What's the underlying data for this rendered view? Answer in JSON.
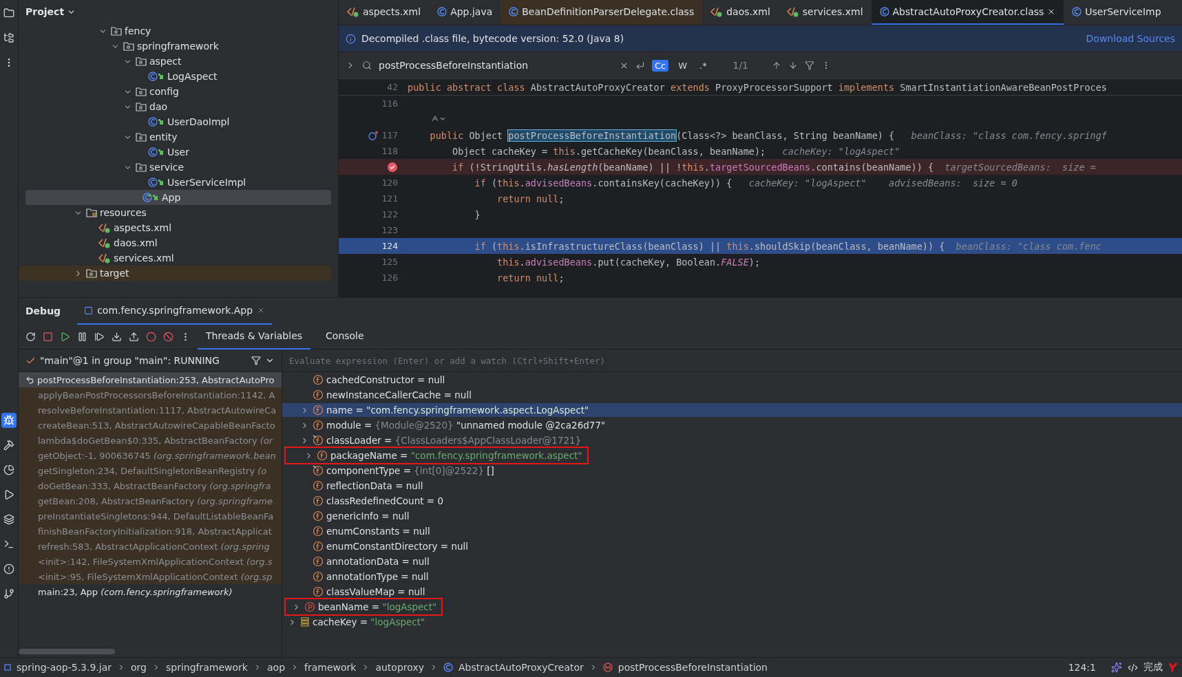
{
  "project": {
    "title": "Project",
    "tree": {
      "continued": [
        {
          "label": "fency",
          "kind": "folder",
          "expanded": true,
          "selected": false,
          "excluded": false,
          "children": [
            {
              "label": "springframework",
              "kind": "folder",
              "expanded": true,
              "selected": false,
              "excluded": false,
              "children": [
                {
                  "label": "aspect",
                  "kind": "folder",
                  "expanded": true,
                  "selected": false,
                  "excluded": false,
                  "children": [
                    {
                      "label": "LogAspect",
                      "kind": "class",
                      "selected": false,
                      "excluded": false
                    }
                  ]
                },
                {
                  "label": "config",
                  "kind": "folder",
                  "expanded": true,
                  "selected": false,
                  "excluded": false
                },
                {
                  "label": "dao",
                  "kind": "folder",
                  "expanded": true,
                  "selected": false,
                  "excluded": false,
                  "children": [
                    {
                      "label": "UserDaoImpl",
                      "kind": "class",
                      "selected": false,
                      "excluded": false
                    }
                  ]
                },
                {
                  "label": "entity",
                  "kind": "folder",
                  "expanded": true,
                  "selected": false,
                  "excluded": false,
                  "children": [
                    {
                      "label": "User",
                      "kind": "class",
                      "selected": false,
                      "excluded": false
                    }
                  ]
                },
                {
                  "label": "service",
                  "kind": "folder",
                  "expanded": true,
                  "selected": false,
                  "excluded": false,
                  "children": [
                    {
                      "label": "UserServiceImpl",
                      "kind": "class",
                      "selected": false,
                      "excluded": false
                    }
                  ]
                },
                {
                  "label": "App",
                  "kind": "main-class",
                  "selected": true,
                  "excluded": false
                }
              ]
            }
          ]
        }
      ],
      "items": [
        {
          "label": "resources",
          "kind": "resources",
          "expanded": true,
          "selected": false,
          "excluded": false,
          "children": [
            {
              "label": "aspects.xml",
              "kind": "xml",
              "selected": false,
              "excluded": false
            },
            {
              "label": "daos.xml",
              "kind": "xml",
              "selected": false,
              "excluded": false
            },
            {
              "label": "services.xml",
              "kind": "xml",
              "selected": false,
              "excluded": false
            }
          ]
        },
        {
          "label": "target",
          "kind": "folder",
          "expanded": false,
          "selected": false,
          "excluded": true
        }
      ]
    }
  },
  "editor": {
    "tabs": [
      {
        "label": "aspects.xml",
        "kind": "xml",
        "selected": false,
        "tinted": false
      },
      {
        "label": "App.java",
        "kind": "class",
        "selected": false,
        "tinted": false
      },
      {
        "label": "BeanDefinitionParserDelegate.class",
        "kind": "class",
        "selected": false,
        "tinted": true
      },
      {
        "label": "daos.xml",
        "kind": "xml",
        "selected": false,
        "tinted": false
      },
      {
        "label": "services.xml",
        "kind": "xml",
        "selected": false,
        "tinted": false
      },
      {
        "label": "AbstractAutoProxyCreator.class",
        "kind": "class",
        "selected": true,
        "tinted": false
      },
      {
        "label": "UserServiceImp",
        "kind": "class",
        "selected": false,
        "tinted": false
      }
    ],
    "banner": {
      "text": "Decompiled .class file, bytecode version: 52.0 (Java 8)",
      "link": "Download Sources"
    },
    "find": {
      "value": "postProcessBeforeInstantiation",
      "match_case": true,
      "words": false,
      "regex": false,
      "case_label": "Cc",
      "words_label": "W",
      "regex_label": ".*",
      "count": "1/1"
    },
    "lines": [
      {
        "kind": "code",
        "number": "42",
        "sticky": true,
        "breakpoint": false,
        "current": false,
        "tokens": [
          {
            "text": "public abstract class ",
            "kind": "kw"
          },
          {
            "text": "AbstractAutoProxyCreator ",
            "kind": "plain"
          },
          {
            "text": "extends ",
            "kind": "kw"
          },
          {
            "text": "ProxyProcessorSupport ",
            "kind": "plain"
          },
          {
            "text": "implements ",
            "kind": "kw"
          },
          {
            "text": "SmartInstantiationAwareBeanPostProces",
            "kind": "plain"
          }
        ]
      },
      {
        "kind": "code",
        "number": "116",
        "sticky": false,
        "breakpoint": false,
        "current": false
      },
      {
        "kind": "hint"
      },
      {
        "kind": "code",
        "number": "117",
        "sticky": false,
        "breakpoint": false,
        "current": false,
        "override": true,
        "tokens": [
          {
            "text": "    public ",
            "kind": "kw"
          },
          {
            "text": "Object ",
            "kind": "plain"
          },
          {
            "text": "postProcessBeforeInstantiation",
            "kind": "match"
          },
          {
            "text": "(Class<?> beanClass, String beanName) {   ",
            "kind": "plain"
          },
          {
            "text": "beanClass: \"class com.fency.springf",
            "kind": "hint"
          }
        ]
      },
      {
        "kind": "code",
        "number": "118",
        "sticky": false,
        "breakpoint": false,
        "current": false,
        "tokens": [
          {
            "text": "        Object cacheKey = ",
            "kind": "plain"
          },
          {
            "text": "this",
            "kind": "kw"
          },
          {
            "text": ".getCacheKey(beanClass, beanName);   ",
            "kind": "plain"
          },
          {
            "text": "cacheKey: \"logAspect\"",
            "kind": "hint"
          }
        ]
      },
      {
        "kind": "code",
        "sticky": false,
        "breakpoint": true,
        "current": false,
        "tokens": [
          {
            "text": "        if ",
            "kind": "kw"
          },
          {
            "text": "(!StringUtils.",
            "kind": "plain"
          },
          {
            "text": "hasLength",
            "kind": "italic"
          },
          {
            "text": "(beanName) || !",
            "kind": "plain"
          },
          {
            "text": "this",
            "kind": "kw"
          },
          {
            "text": ".",
            "kind": "plain"
          },
          {
            "text": "targetSourcedBeans",
            "kind": "field"
          },
          {
            "text": ".contains(beanName)) {  ",
            "kind": "plain"
          },
          {
            "text": "targetSourcedBeans:  size =",
            "kind": "hint"
          }
        ]
      },
      {
        "kind": "code",
        "number": "120",
        "sticky": false,
        "breakpoint": false,
        "current": false,
        "tokens": [
          {
            "text": "            if ",
            "kind": "kw"
          },
          {
            "text": "(",
            "kind": "plain"
          },
          {
            "text": "this",
            "kind": "kw"
          },
          {
            "text": ".",
            "kind": "plain"
          },
          {
            "text": "advisedBeans",
            "kind": "field"
          },
          {
            "text": ".containsKey(cacheKey)) {   ",
            "kind": "plain"
          },
          {
            "text": "cacheKey: \"logAspect\"    advisedBeans:  size = 0",
            "kind": "hint"
          }
        ]
      },
      {
        "kind": "code",
        "number": "121",
        "sticky": false,
        "breakpoint": false,
        "current": false,
        "tokens": [
          {
            "text": "                return null",
            "kind": "kw"
          },
          {
            "text": ";",
            "kind": "plain"
          }
        ]
      },
      {
        "kind": "code",
        "number": "122",
        "sticky": false,
        "breakpoint": false,
        "current": false,
        "tokens": [
          {
            "text": "            }",
            "kind": "plain"
          }
        ]
      },
      {
        "kind": "code",
        "number": "123",
        "sticky": false,
        "breakpoint": false,
        "current": false
      },
      {
        "kind": "code",
        "number": "124",
        "sticky": false,
        "breakpoint": false,
        "current": true,
        "tokens": [
          {
            "text": "            if ",
            "kind": "kw"
          },
          {
            "text": "(",
            "kind": "plain"
          },
          {
            "text": "this",
            "kind": "kw"
          },
          {
            "text": ".isInfrastructureClass(beanClass) || ",
            "kind": "plain"
          },
          {
            "text": "this",
            "kind": "kw"
          },
          {
            "text": ".shouldSkip(beanClass, beanName)) {  ",
            "kind": "plain"
          },
          {
            "text": "beanClass: \"class com.fenc",
            "kind": "hint"
          }
        ]
      },
      {
        "kind": "code",
        "number": "125",
        "sticky": false,
        "breakpoint": false,
        "current": false,
        "tokens": [
          {
            "text": "                this",
            "kind": "kw"
          },
          {
            "text": ".",
            "kind": "plain"
          },
          {
            "text": "advisedBeans",
            "kind": "field"
          },
          {
            "text": ".put(cacheKey, Boolean.",
            "kind": "plain"
          },
          {
            "text": "FALSE",
            "kind": "const"
          },
          {
            "text": ");",
            "kind": "plain"
          }
        ]
      },
      {
        "kind": "code",
        "number": "126",
        "sticky": false,
        "breakpoint": false,
        "current": false,
        "tokens": [
          {
            "text": "                return null",
            "kind": "kw"
          },
          {
            "text": ";",
            "kind": "plain"
          }
        ]
      }
    ]
  },
  "debug": {
    "title": "Debug",
    "session": "com.fency.springframework.App",
    "tabs": [
      {
        "label": "Threads & Variables",
        "selected": true
      },
      {
        "label": "Console",
        "selected": false
      }
    ],
    "thread": "\"main\"@1 in group \"main\": RUNNING",
    "evaluate": {
      "placeholder": "Evaluate expression (Enter) or add a watch (Ctrl+Shift+Enter)"
    },
    "frames": [
      {
        "text": "postProcessBeforeInstantiation:253, AbstractAutoPro",
        "library": true,
        "selected": true
      },
      {
        "text": "applyBeanPostProcessorsBeforeInstantiation:1142, A",
        "library": true,
        "selected": false
      },
      {
        "text": "resolveBeforeInstantiation:1117, AbstractAutowireCa",
        "library": true,
        "selected": false
      },
      {
        "text": "createBean:513, AbstractAutowireCapableBeanFacto",
        "library": true,
        "selected": false
      },
      {
        "text": "lambda$doGetBean$0:335, AbstractBeanFactory *(or*",
        "library": true,
        "selected": false
      },
      {
        "text": "getObject:-1, 900636745 *(org.springframework.bean*",
        "library": true,
        "selected": false
      },
      {
        "text": "getSingleton:234, DefaultSingletonBeanRegistry *(o*",
        "library": true,
        "selected": false
      },
      {
        "text": "doGetBean:333, AbstractBeanFactory *(org.springfra*",
        "library": true,
        "selected": false
      },
      {
        "text": "getBean:208, AbstractBeanFactory *(org.springframe*",
        "library": true,
        "selected": false
      },
      {
        "text": "preInstantiateSingletons:944, DefaultListableBeanFa",
        "library": true,
        "selected": false
      },
      {
        "text": "finishBeanFactoryInitialization:918, AbstractApplicat",
        "library": true,
        "selected": false
      },
      {
        "text": "refresh:583, AbstractApplicationContext *(org.spring*",
        "library": true,
        "selected": false
      },
      {
        "text": "<init>:142, FileSystemXmlApplicationContext *(org.s*",
        "library": true,
        "selected": false
      },
      {
        "text": "<init>:95, FileSystemXmlApplicationContext *(org.sp*",
        "library": true,
        "selected": false
      },
      {
        "text": "main:23, App *(com.fency.springframework)*",
        "library": false,
        "selected": false
      }
    ],
    "variables": {
      "continued": [
        {
          "label": "cachedConstructor =",
          "kind": "field",
          "expandable": false,
          "selected": false,
          "boxed": false,
          "value": {
            "text": "null",
            "kind": "plain"
          }
        },
        {
          "label": "newInstanceCallerCache =",
          "kind": "field",
          "expandable": false,
          "selected": false,
          "boxed": false,
          "value": {
            "text": "null",
            "kind": "plain"
          }
        },
        {
          "label": "name =",
          "kind": "field",
          "expandable": true,
          "selected": true,
          "boxed": false,
          "value": {
            "text": "\"com.fency.springframework.aspect.LogAspect\"",
            "kind": "string"
          }
        },
        {
          "label": "module =",
          "kind": "field",
          "expandable": true,
          "selected": false,
          "boxed": false,
          "ref": "{Module@2520}",
          "value": {
            "text": "\"unnamed module @2ca26d77\"",
            "kind": "plain"
          }
        },
        {
          "label": "classLoader =",
          "kind": "field-static",
          "expandable": true,
          "selected": false,
          "boxed": false,
          "ref": "{ClassLoaders$AppClassLoader@1721}"
        },
        {
          "label": "packageName =",
          "kind": "field",
          "expandable": true,
          "selected": false,
          "boxed": true,
          "value": {
            "text": "\"com.fency.springframework.aspect\"",
            "kind": "string"
          }
        },
        {
          "label": "componentType =",
          "kind": "field-static",
          "expandable": false,
          "selected": false,
          "boxed": false,
          "ref": "{int[0]@2522}",
          "value": {
            "text": "[]",
            "kind": "plain"
          }
        },
        {
          "label": "reflectionData =",
          "kind": "field",
          "expandable": false,
          "selected": false,
          "boxed": false,
          "value": {
            "text": "null",
            "kind": "plain"
          }
        },
        {
          "label": "classRedefinedCount =",
          "kind": "field",
          "expandable": false,
          "selected": false,
          "boxed": false,
          "value": {
            "text": "0",
            "kind": "plain"
          }
        },
        {
          "label": "genericInfo =",
          "kind": "field",
          "expandable": false,
          "selected": false,
          "boxed": false,
          "value": {
            "text": "null",
            "kind": "plain"
          }
        },
        {
          "label": "enumConstants =",
          "kind": "field",
          "expandable": false,
          "selected": false,
          "boxed": false,
          "value": {
            "text": "null",
            "kind": "plain"
          }
        },
        {
          "label": "enumConstantDirectory =",
          "kind": "field",
          "expandable": false,
          "selected": false,
          "boxed": false,
          "value": {
            "text": "null",
            "kind": "plain"
          }
        },
        {
          "label": "annotationData =",
          "kind": "field",
          "expandable": false,
          "selected": false,
          "boxed": false,
          "value": {
            "text": "null",
            "kind": "plain"
          }
        },
        {
          "label": "annotationType =",
          "kind": "field",
          "expandable": false,
          "selected": false,
          "boxed": false,
          "value": {
            "text": "null",
            "kind": "plain"
          }
        },
        {
          "label": "classValueMap =",
          "kind": "field",
          "expandable": false,
          "selected": false,
          "boxed": false,
          "value": {
            "text": "null",
            "kind": "plain"
          }
        }
      ],
      "items": [
        {
          "label": "beanName =",
          "kind": "param",
          "expandable": true,
          "selected": false,
          "boxed": true,
          "value": {
            "text": "\"logAspect\"",
            "kind": "string"
          }
        },
        {
          "label": "cacheKey =",
          "kind": "local",
          "expandable": true,
          "selected": false,
          "boxed": false,
          "value": {
            "text": "\"logAspect\"",
            "kind": "string"
          }
        }
      ]
    }
  },
  "status_bar": {
    "breadcrumbs": [
      {
        "label": "spring-aop-5.3.9.jar",
        "kind": "archive"
      },
      {
        "label": "org",
        "kind": "package"
      },
      {
        "label": "springframework",
        "kind": "package"
      },
      {
        "label": "aop",
        "kind": "package"
      },
      {
        "label": "framework",
        "kind": "package"
      },
      {
        "label": "autoproxy",
        "kind": "package"
      },
      {
        "label": "AbstractAutoProxyCreator",
        "kind": "class"
      },
      {
        "label": "postProcessBeforeInstantiation",
        "kind": "method"
      }
    ],
    "position": "124:1",
    "assistant": "完成"
  }
}
